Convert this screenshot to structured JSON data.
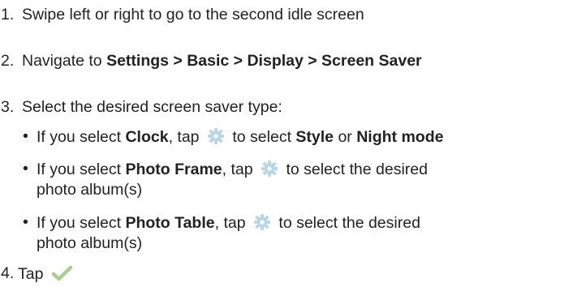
{
  "steps": [
    {
      "number": "1.",
      "text": "Swipe left or right to go to the second idle screen"
    },
    {
      "number": "2.",
      "prefix": "Navigate to ",
      "path": "Settings > Basic > Display > Screen Saver"
    },
    {
      "number": "3.",
      "text": "Select the desired screen saver type:",
      "bullets": [
        {
          "dot": "•",
          "lead": "If you select ",
          "option": "Clock",
          "mid": ", tap ",
          "icon": "gear-icon",
          "tail_prefix": " to select ",
          "choice_a": "Style",
          "or_word": " or ",
          "choice_b": "Night mode"
        },
        {
          "dot": "•",
          "lead": "If you select ",
          "option": "Photo Frame",
          "mid": ", tap ",
          "icon": "gear-icon",
          "tail": " to select the desired",
          "line2": "photo album(s)"
        },
        {
          "dot": "•",
          "lead": "If you select ",
          "option": "Photo Table",
          "mid": ", tap ",
          "icon": "gear-icon",
          "tail": " to select the desired",
          "line2": "photo album(s)"
        }
      ]
    },
    {
      "number": "4.",
      "text": "Tap",
      "icon": "checkmark-icon"
    }
  ],
  "colors": {
    "text": "#222222",
    "gear": "#b8d7e4",
    "check": "#a9ce8d"
  }
}
